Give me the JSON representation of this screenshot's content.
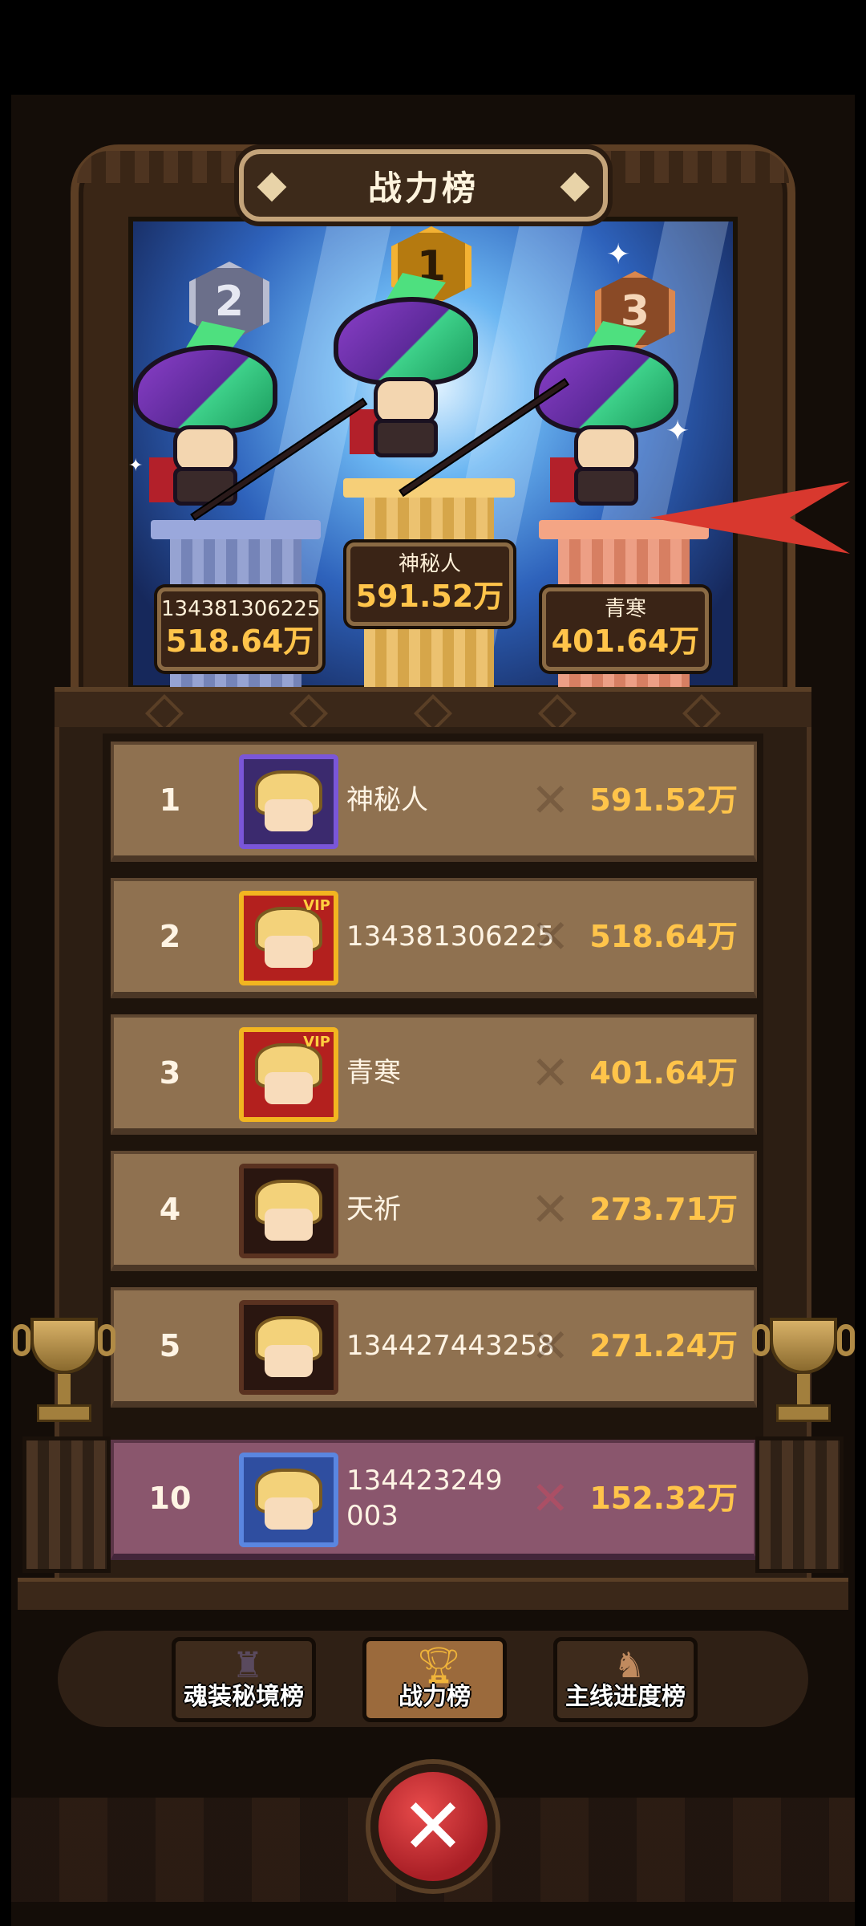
{
  "header": {
    "title": "战力榜"
  },
  "podium": [
    {
      "place": "2",
      "name": "134381306225",
      "power": "518.64万",
      "medal_color": "#b8bcd0",
      "pillar_color": "#7f8fc8"
    },
    {
      "place": "1",
      "name": "神秘人",
      "power": "591.52万",
      "medal_color": "#f3b233",
      "pillar_color": "#e8b450"
    },
    {
      "place": "3",
      "name": "青寒",
      "power": "401.64万",
      "medal_color": "#d9874f",
      "pillar_color": "#e98a6a"
    }
  ],
  "rankings": [
    {
      "rank": "1",
      "name": "神秘人",
      "power": "591.52万",
      "frame": "#7a56d8",
      "vip": "",
      "self": false
    },
    {
      "rank": "2",
      "name": "134381306225",
      "power": "518.64万",
      "frame": "#f2b520",
      "vip": "VIP",
      "self": false
    },
    {
      "rank": "3",
      "name": "青寒",
      "power": "401.64万",
      "frame": "#f2b520",
      "vip": "VIP",
      "self": false
    },
    {
      "rank": "4",
      "name": "天祈",
      "power": "273.71万",
      "frame": "#5a3220",
      "vip": "",
      "self": false
    },
    {
      "rank": "5",
      "name": "134427443258",
      "power": "271.24万",
      "frame": "#5a3220",
      "vip": "",
      "self": false
    },
    {
      "rank": "10",
      "name": "134423249003",
      "power": "152.32万",
      "frame": "#5a86e0",
      "vip": "",
      "self": true
    }
  ],
  "tabs": [
    {
      "label": "魂装秘境榜",
      "icon": "soul-gear-icon",
      "active": false
    },
    {
      "label": "战力榜",
      "icon": "trophy-icon",
      "active": true
    },
    {
      "label": "主线进度榜",
      "icon": "progress-icon",
      "active": false
    }
  ],
  "close": {
    "icon": "close-icon"
  },
  "colors": {
    "power_text": "#ffc44a",
    "self_row": "#8a566d",
    "row": "#8f7150"
  }
}
